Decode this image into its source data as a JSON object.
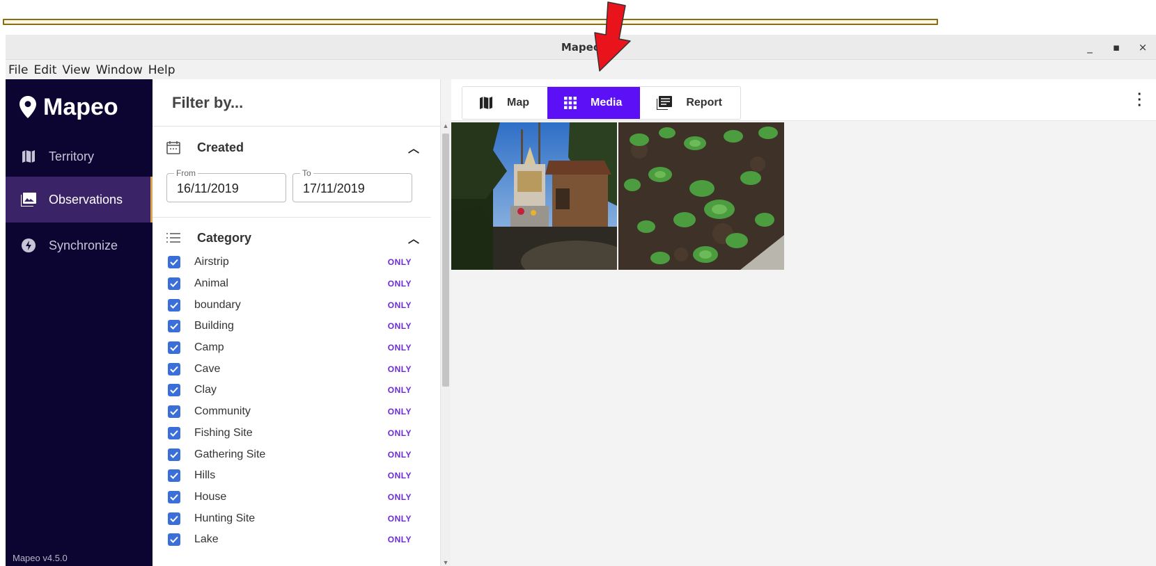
{
  "window": {
    "title": "Mapeo",
    "controls": [
      "_",
      "▪",
      "×"
    ]
  },
  "menu": [
    "File",
    "Edit",
    "View",
    "Window",
    "Help"
  ],
  "sidebar": {
    "app_name": "Mapeo",
    "items": [
      {
        "label": "Territory",
        "icon": "map-icon",
        "active": false
      },
      {
        "label": "Observations",
        "icon": "photo-icon",
        "active": true
      },
      {
        "label": "Synchronize",
        "icon": "sync-bolt-icon",
        "active": false
      }
    ],
    "version": "Mapeo v4.5.0"
  },
  "filter": {
    "title": "Filter by...",
    "created": {
      "label": "Created",
      "from_label": "From",
      "from_value": "16/11/2019",
      "to_label": "To",
      "to_value": "17/11/2019"
    },
    "category": {
      "label": "Category",
      "only_label": "ONLY",
      "items": [
        "Airstrip",
        "Animal",
        "boundary",
        "Building",
        "Camp",
        "Cave",
        "Clay",
        "Community",
        "Fishing Site",
        "Gathering Site",
        "Hills",
        "House",
        "Hunting Site",
        "Lake"
      ]
    }
  },
  "toolbar": {
    "tabs": [
      {
        "label": "Map",
        "icon": "map-icon",
        "active": false
      },
      {
        "label": "Media",
        "icon": "grid-icon",
        "active": true
      },
      {
        "label": "Report",
        "icon": "report-icon",
        "active": false
      }
    ]
  },
  "media": [
    {
      "subject": "shrine-photo"
    },
    {
      "subject": "seedlings-photo"
    }
  ],
  "colors": {
    "sidebar_bg": "#0c0531",
    "sidebar_active": "#3a2467",
    "accent_purple": "#5b10f5",
    "checkbox_blue": "#3a6ed8",
    "only_purple": "#6b2bd9",
    "annotation_arrow": "#e8131b"
  }
}
